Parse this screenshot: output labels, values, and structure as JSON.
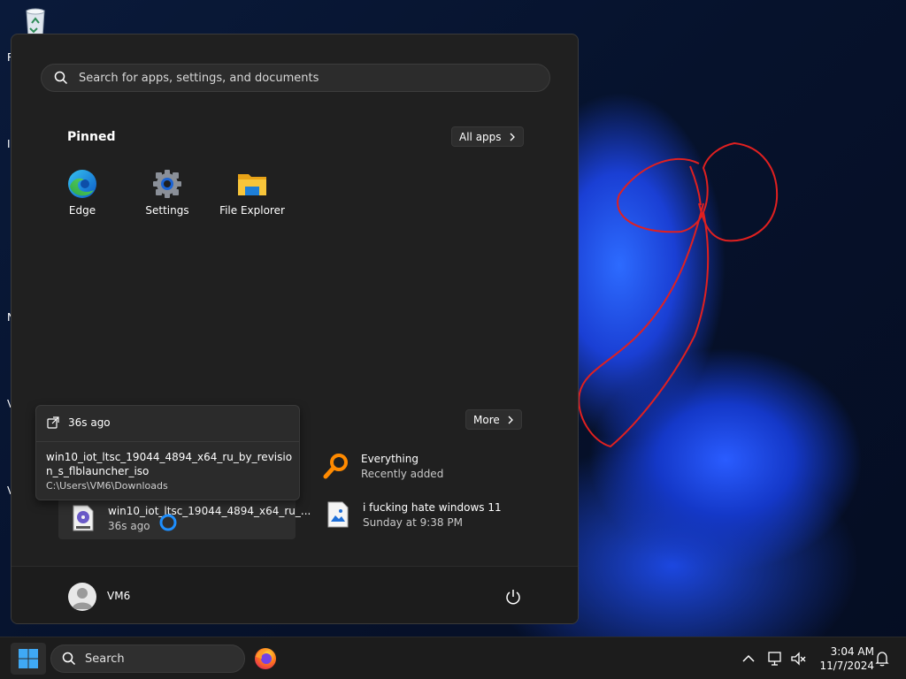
{
  "desktop": {
    "partial_letters": [
      "R",
      "I",
      "N",
      "V",
      "V"
    ]
  },
  "start_menu": {
    "search_placeholder": "Search for apps, settings, and documents",
    "pinned": {
      "title": "Pinned",
      "all_apps_label": "All apps",
      "apps": [
        {
          "name": "Edge",
          "icon": "edge-icon"
        },
        {
          "name": "Settings",
          "icon": "gear-icon"
        },
        {
          "name": "File Explorer",
          "icon": "folder-icon"
        }
      ]
    },
    "recommended": {
      "more_label": "More",
      "items": [
        {
          "title": "Everything",
          "subtitle": "Recently added",
          "icon": "magnifier-app-icon"
        },
        {
          "title": "win10_iot_ltsc_19044_4894_x64_ru_...",
          "subtitle": "36s ago",
          "icon": "disc-image-icon"
        },
        {
          "title": "i fucking hate windows 11",
          "subtitle": "Sunday at 9:38 PM",
          "icon": "image-file-icon"
        }
      ]
    },
    "tooltip": {
      "time": "36s ago",
      "full_name": "win10_iot_ltsc_19044_4894_x64_ru_by_revision_s_flblauncher_iso",
      "path": "C:\\Users\\VM6\\Downloads"
    },
    "user": {
      "name": "VM6"
    }
  },
  "taskbar": {
    "search_label": "Search",
    "time": "3:04 AM",
    "date": "11/7/2024"
  },
  "colors": {
    "menu_bg": "#202020",
    "accent_blue": "#1a73e8",
    "scribble_red": "#e02020"
  }
}
